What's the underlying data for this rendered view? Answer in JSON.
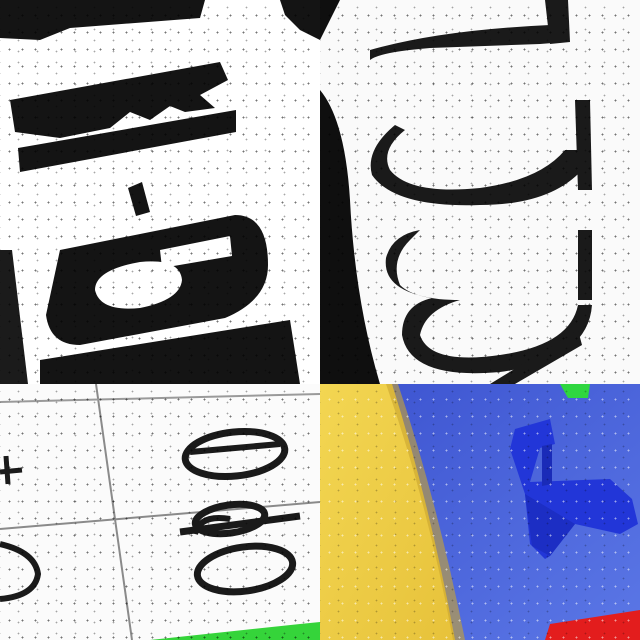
{
  "scene": {
    "description_tiles": 4
  },
  "tiles": [
    {
      "name": "bold-black-letters-tile"
    },
    {
      "name": "serif-digits-tile",
      "glyphs": [
        "Γ",
        "5",
        "3",
        "Z"
      ]
    },
    {
      "name": "grid-letters-tile",
      "glyphs": [
        "e",
        "o",
        "r",
        "o",
        "c",
        "+"
      ]
    },
    {
      "name": "toy-letter-tile",
      "glyph": "T"
    }
  ],
  "colors": {
    "ink": "#141414",
    "paper": "#ffffff",
    "toy_blue": "#2338d6",
    "backdrop_blue": "#4a66e0",
    "yellow": "#f1d04a",
    "green": "#39d43a",
    "red": "#e21e1e"
  }
}
